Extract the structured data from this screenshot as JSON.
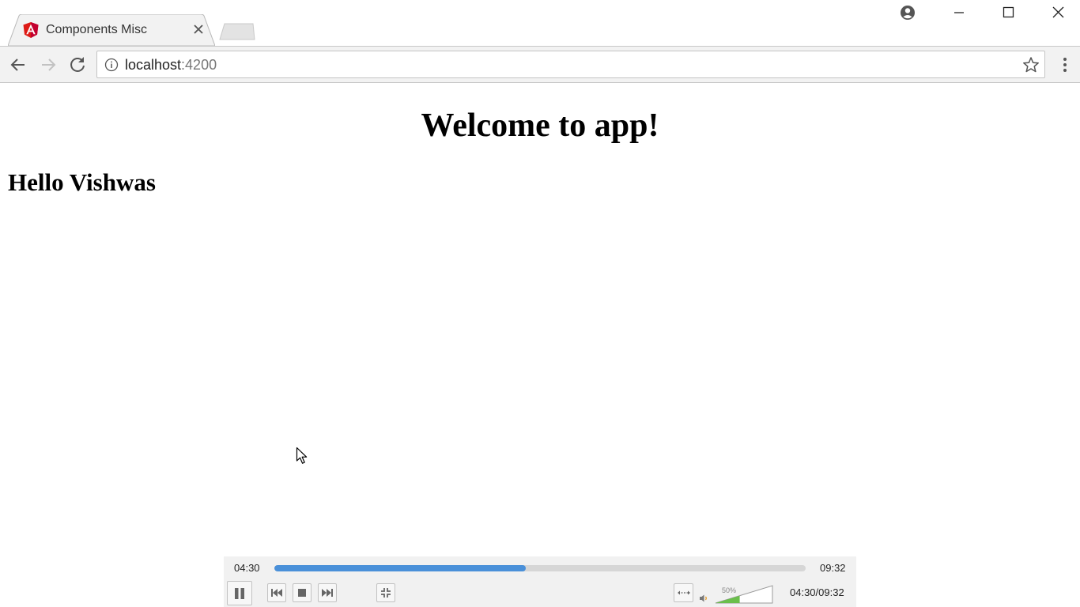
{
  "browser": {
    "tab": {
      "title": "Components Misc",
      "favicon": "angular-logo-icon",
      "close_icon": "close-icon"
    },
    "window_controls": [
      "profile-icon",
      "minimize-icon",
      "maximize-icon",
      "close-icon"
    ],
    "nav": {
      "back_icon": "back-arrow-icon",
      "forward_icon": "forward-arrow-icon",
      "reload_icon": "reload-icon"
    },
    "address": {
      "host": "localhost",
      "port": ":4200",
      "security_icon": "info-icon",
      "bookmark_icon": "star-icon"
    },
    "menu_icon": "kebab-menu-icon"
  },
  "page": {
    "heading": "Welcome to app!",
    "greeting": "Hello Vishwas"
  },
  "player": {
    "current_time": "04:30",
    "total_time": "09:32",
    "progress_fraction": 0.473,
    "volume_label": "50%",
    "volume_fraction": 0.5,
    "timecode": "04:30/09:32",
    "colors": {
      "progress": "#4a90d9",
      "volume": "#6abf4b"
    }
  }
}
